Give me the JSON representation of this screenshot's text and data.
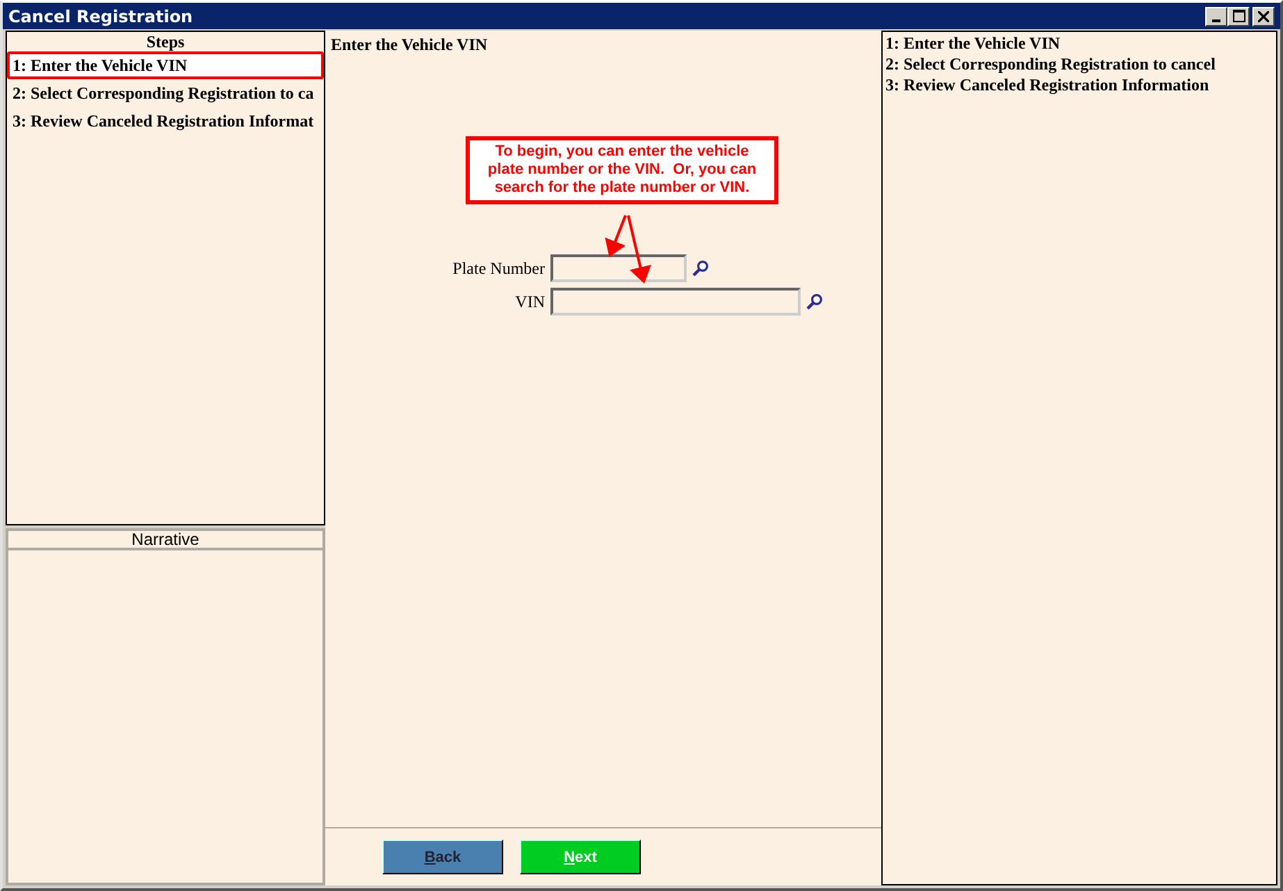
{
  "window": {
    "title": "Cancel Registration"
  },
  "steps_panel": {
    "title": "Steps",
    "items": [
      {
        "label": "1: Enter the Vehicle VIN",
        "selected": true
      },
      {
        "label": "2: Select Corresponding Registration to ca",
        "selected": false
      },
      {
        "label": "3: Review Canceled Registration Informat",
        "selected": false
      }
    ]
  },
  "narrative_panel": {
    "title": "Narrative"
  },
  "main": {
    "heading": "Enter the Vehicle VIN",
    "callout": "To begin, you can enter the vehicle plate number or the VIN.  Or, you can search for the plate number or VIN.",
    "fields": [
      {
        "label": "Plate Number",
        "kind": "short"
      },
      {
        "label": "VIN",
        "kind": "long"
      }
    ],
    "buttons": [
      {
        "label": "Back",
        "kind": "back"
      },
      {
        "label": "Next",
        "kind": "next"
      }
    ]
  },
  "summary_panel": {
    "items": [
      "1: Enter the Vehicle VIN",
      "2: Select Corresponding Registration to cancel",
      "3: Review Canceled Registration Information"
    ]
  }
}
